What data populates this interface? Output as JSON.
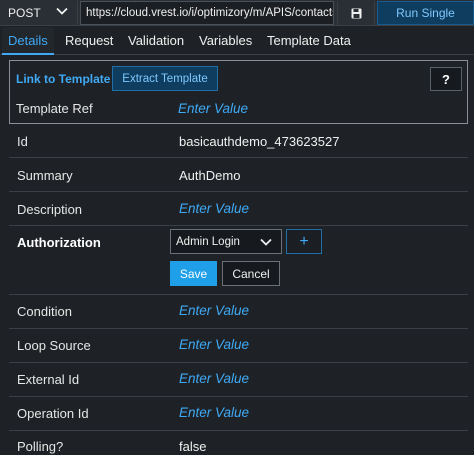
{
  "toolbar": {
    "method": "POST",
    "url": "https://cloud.vrest.io/i/optimizory/m/APIS/contacts",
    "run_label": "Run Single"
  },
  "tabs": [
    {
      "label": "Details"
    },
    {
      "label": "Request"
    },
    {
      "label": "Validation"
    },
    {
      "label": "Variables"
    },
    {
      "label": "Template Data"
    }
  ],
  "template": {
    "link_label": "Link to Template",
    "extract_label": "Extract Template",
    "help_label": "?",
    "ref_label": "Template Ref",
    "ref_placeholder": "Enter Value"
  },
  "fields": {
    "id": {
      "label": "Id",
      "value": "basicauthdemo_473623527"
    },
    "summary": {
      "label": "Summary",
      "value": "AuthDemo"
    },
    "description": {
      "label": "Description",
      "value": "Enter Value"
    },
    "authorization": {
      "label": "Authorization",
      "selected": "Admin Login",
      "plus": "+",
      "save": "Save",
      "cancel": "Cancel"
    },
    "condition": {
      "label": "Condition",
      "value": "Enter Value"
    },
    "loop_source": {
      "label": "Loop Source",
      "value": "Enter Value"
    },
    "external_id": {
      "label": "External Id",
      "value": "Enter Value"
    },
    "operation_id": {
      "label": "Operation Id",
      "value": "Enter Value"
    },
    "polling": {
      "label": "Polling?",
      "value": "false"
    }
  },
  "colors": {
    "accent": "#3fa9f5",
    "primary_button": "#1e9fe8",
    "background": "#1e2226"
  }
}
